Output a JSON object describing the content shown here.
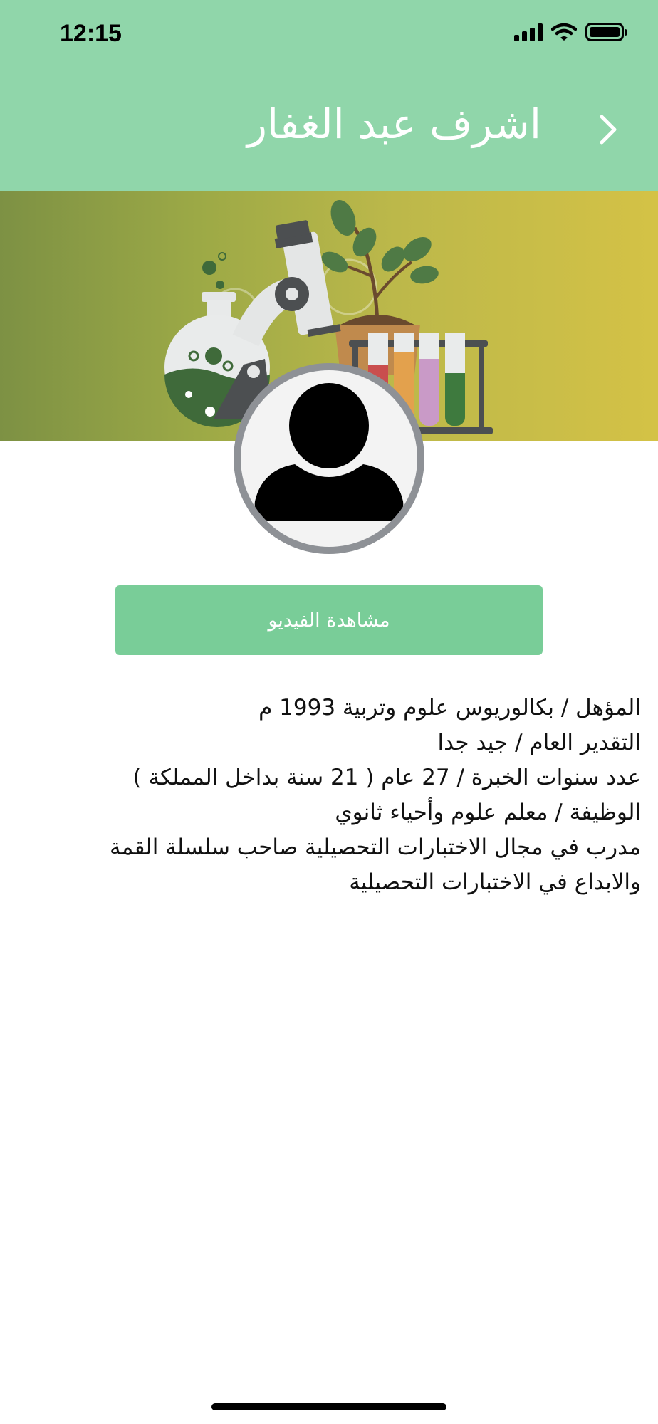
{
  "status_bar": {
    "time": "12:15",
    "background": "#90d6aa",
    "icons": [
      "signal-icon",
      "wifi-icon",
      "battery-icon"
    ]
  },
  "nav": {
    "title": "اشرف عبد الغفار",
    "back_icon": "chevron-icon",
    "background": "#90d6aa",
    "title_color": "#ffffff"
  },
  "banner": {
    "illustration": "science-lab-illustration",
    "colors": [
      "#7d9144",
      "#d4c246"
    ]
  },
  "profile": {
    "avatar_icon": "user-silhouette-icon"
  },
  "video_button": {
    "label": "مشاهدة الفيديو",
    "background": "#79cd98"
  },
  "details": {
    "lines": [
      "المؤهل / بكالوريوس علوم وتربية 1993 م",
      "التقدير العام / جيد  جدا",
      "عدد سنوات الخبرة / 27 عام ( 21 سنة بداخل المملكة )",
      "الوظيفة / معلم علوم وأحياء ثانوي",
      "مدرب في مجال الاختبارات التحصيلية صاحب سلسلة القمة",
      "والابداع في الاختبارات التحصيلية"
    ]
  }
}
